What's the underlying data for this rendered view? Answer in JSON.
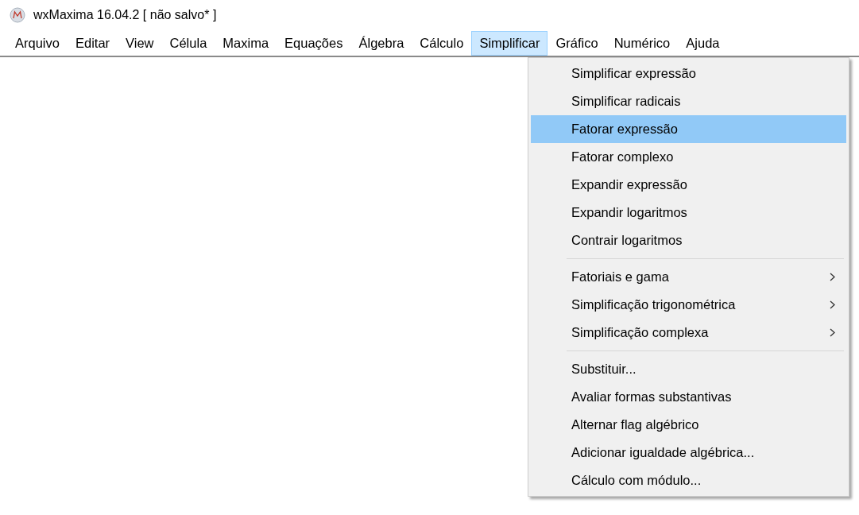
{
  "window": {
    "title": "wxMaxima 16.04.2 [ não salvo* ]"
  },
  "menu_bar": [
    {
      "label": "Arquivo",
      "selected": false
    },
    {
      "label": "Editar",
      "selected": false
    },
    {
      "label": "View",
      "selected": false
    },
    {
      "label": "Célula",
      "selected": false
    },
    {
      "label": "Maxima",
      "selected": false
    },
    {
      "label": "Equações",
      "selected": false
    },
    {
      "label": "Álgebra",
      "selected": false
    },
    {
      "label": "Cálculo",
      "selected": false
    },
    {
      "label": "Simplificar",
      "selected": true
    },
    {
      "label": "Gráfico",
      "selected": false
    },
    {
      "label": "Numérico",
      "selected": false
    },
    {
      "label": "Ajuda",
      "selected": false
    }
  ],
  "dropdown": {
    "groups": [
      [
        {
          "label": "Simplificar expressão",
          "kind": "command",
          "selected": false
        },
        {
          "label": "Simplificar radicais",
          "kind": "command",
          "selected": false
        },
        {
          "label": "Fatorar expressão",
          "kind": "command",
          "selected": true
        },
        {
          "label": "Fatorar complexo",
          "kind": "command",
          "selected": false
        },
        {
          "label": "Expandir expressão",
          "kind": "command",
          "selected": false
        },
        {
          "label": "Expandir logaritmos",
          "kind": "command",
          "selected": false
        },
        {
          "label": "Contrair logaritmos",
          "kind": "command",
          "selected": false
        }
      ],
      [
        {
          "label": "Fatoriais e gama",
          "kind": "submenu",
          "selected": false
        },
        {
          "label": "Simplificação trigonométrica",
          "kind": "submenu",
          "selected": false
        },
        {
          "label": "Simplificação complexa",
          "kind": "submenu",
          "selected": false
        }
      ],
      [
        {
          "label": "Substituir...",
          "kind": "command",
          "selected": false
        },
        {
          "label": "Avaliar formas substantivas",
          "kind": "command",
          "selected": false
        },
        {
          "label": "Alternar flag algébrico",
          "kind": "command",
          "selected": false
        },
        {
          "label": "Adicionar igualdade algébrica...",
          "kind": "command",
          "selected": false
        },
        {
          "label": "Cálculo com módulo...",
          "kind": "command",
          "selected": false
        }
      ]
    ]
  }
}
